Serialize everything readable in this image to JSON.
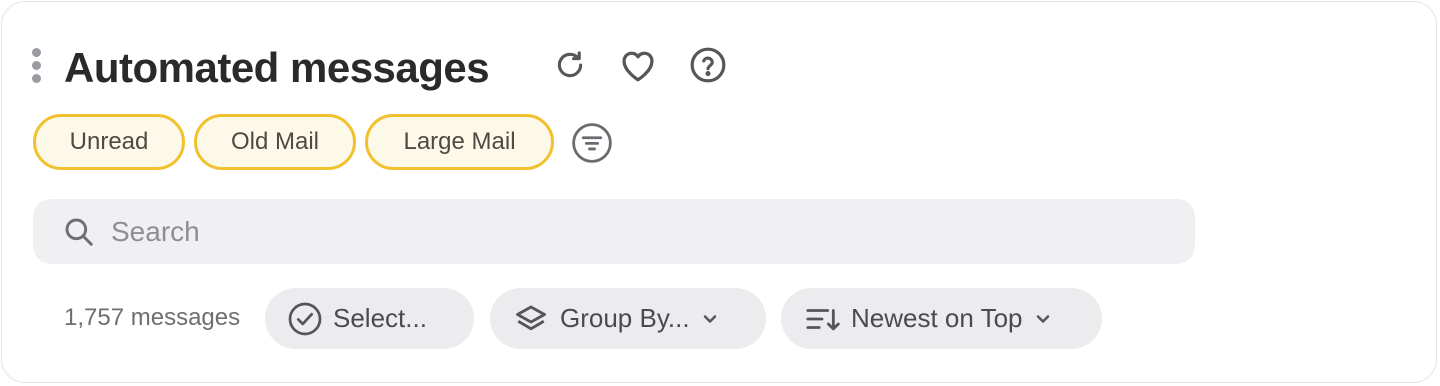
{
  "header": {
    "title": "Automated messages",
    "icons": [
      "drag-handle-icon",
      "refresh-icon",
      "heart-icon",
      "help-icon"
    ]
  },
  "chips": [
    {
      "label": "Unread"
    },
    {
      "label": "Old Mail"
    },
    {
      "label": "Large Mail"
    }
  ],
  "search": {
    "placeholder": "Search",
    "value": ""
  },
  "toolbar": {
    "count": "1,757 messages",
    "select_label": "Select...",
    "group_label": "Group By...",
    "sort_label": "Newest on Top"
  },
  "colors": {
    "chip_border": "#f2c12e",
    "chip_fill": "#fdf9e9",
    "search_fill": "#f0f0f2",
    "pill_fill": "#ececee",
    "title": "#2a2a2d"
  }
}
